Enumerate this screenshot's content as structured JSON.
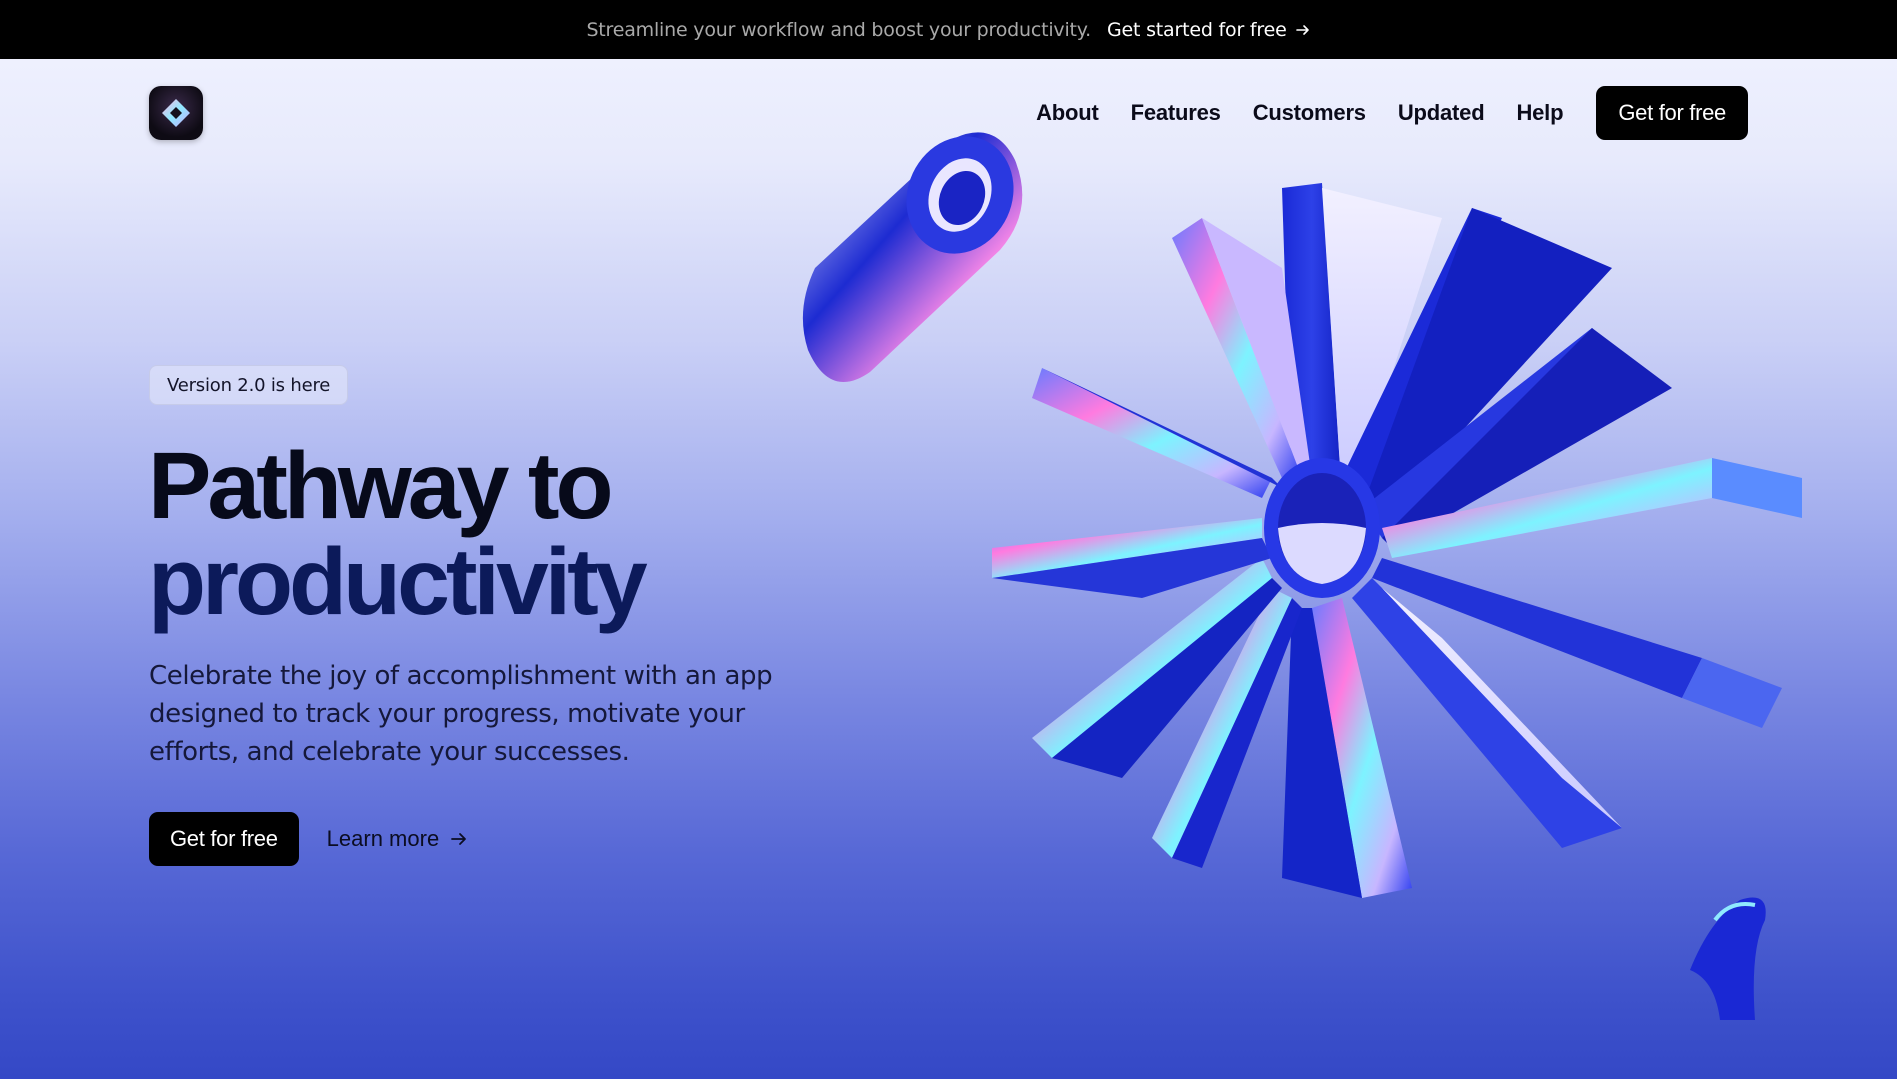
{
  "announcement": {
    "message": "Streamline your workflow and boost your productivity.",
    "cta_label": "Get started for free",
    "cta_icon": "arrow-right-icon"
  },
  "header": {
    "logo_icon": "diamond-logo-icon",
    "nav": [
      {
        "label": "About"
      },
      {
        "label": "Features"
      },
      {
        "label": "Customers"
      },
      {
        "label": "Updated"
      },
      {
        "label": "Help"
      }
    ],
    "cta_label": "Get for free"
  },
  "hero": {
    "badge": "Version 2.0 is here",
    "title_line1": "Pathway to",
    "title_line2": "productivity",
    "description": "Celebrate the joy of accomplishment with an app designed to track your progress, motivate your efforts, and celebrate your successes.",
    "primary_cta": "Get for free",
    "secondary_cta": "Learn more",
    "secondary_icon": "arrow-right-icon"
  },
  "colors": {
    "announce_bg": "#000000",
    "title_dark": "#070a1a",
    "title_navy": "#0c1a5a",
    "accent_blue": "#1f33d8",
    "button_bg": "#000000"
  }
}
